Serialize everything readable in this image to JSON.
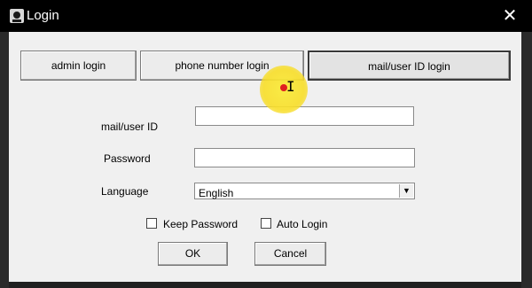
{
  "window": {
    "title": "Login",
    "close_symbol": "✕"
  },
  "tabs": [
    {
      "label": "admin login",
      "selected": false
    },
    {
      "label": "phone number login",
      "selected": false
    },
    {
      "label": "mail/user ID login",
      "selected": true
    }
  ],
  "form": {
    "user_label": "mail/user ID",
    "user_value": "",
    "password_label": "Password",
    "password_value": "",
    "language_label": "Language",
    "language_value": "English",
    "keep_password_label": "Keep Password",
    "keep_password_checked": false,
    "auto_login_label": "Auto Login",
    "auto_login_checked": false
  },
  "buttons": {
    "ok_label": "OK",
    "cancel_label": "Cancel"
  },
  "icons": {
    "app": "app-icon",
    "close": "close-icon",
    "dropdown": "chevron-down-icon",
    "cursor": "text-cursor-icon"
  },
  "colors": {
    "titlebar": "#000000",
    "dialog_bg": "#f0f0f0",
    "cursor_highlight": "#f5d92a"
  }
}
